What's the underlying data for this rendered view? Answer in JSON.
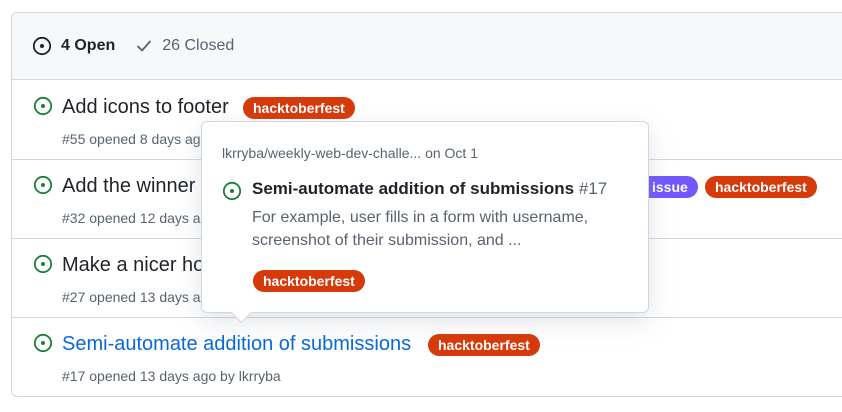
{
  "header": {
    "open_label": "4 Open",
    "closed_label": "26 Closed"
  },
  "colors": {
    "open_icon": "#1a7f37",
    "hacktoberfest": "#d73a0a",
    "good_first_issue": "#7057ff",
    "link": "#0969da"
  },
  "issues": [
    {
      "title": "Add icons to footer",
      "meta": "#55 opened 8 days ago",
      "labels": [
        "hacktoberfest"
      ]
    },
    {
      "title": "Add the winner",
      "meta": "#32 opened 12 days ago",
      "labels": [
        "issue",
        "hacktoberfest"
      ]
    },
    {
      "title": "Make a nicer ho",
      "meta": "#27 opened 13 days ago",
      "labels": []
    },
    {
      "title": "Semi-automate addition of submissions",
      "meta": "#17 opened 13 days ago by lkrryba",
      "labels": [
        "hacktoberfest"
      ]
    }
  ],
  "popover": {
    "repo": "lkrryba/weekly-web-dev-challe... on Oct 1",
    "title": "Semi-automate addition of submissions",
    "number": "#17",
    "body": "For example, user fills in a form with username, screenshot of their submission, and ...",
    "label": "hacktoberfest"
  }
}
